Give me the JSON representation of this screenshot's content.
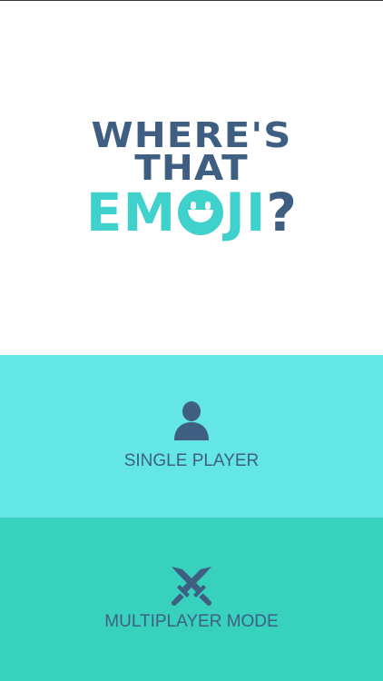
{
  "logo": {
    "line1": "WHERE'S",
    "line2": "THAT",
    "line3_prefix": "EM",
    "line3_suffix": "JI",
    "line3_mark": "?"
  },
  "menu": {
    "single_player_label": "SINGLE PLAYER",
    "multiplayer_label": "MULTIPLAYER MODE",
    "single_player_icon": "person-icon",
    "multiplayer_icon": "crossed-swords-icon"
  },
  "colors": {
    "brand_navy": "#3f5f82",
    "brand_teal": "#3fd1cc",
    "single_bg": "#63e6e4",
    "multi_bg": "#38d1be"
  }
}
